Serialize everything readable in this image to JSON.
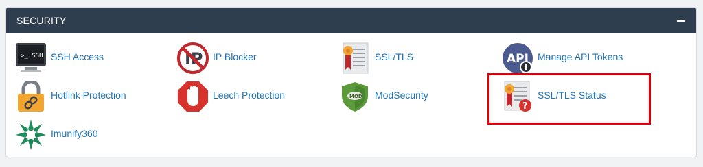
{
  "section": {
    "title": "SECURITY",
    "collapse_icon": "minus-icon"
  },
  "items": [
    {
      "label": "SSH Access",
      "icon": "terminal-icon",
      "icon_text": ">_ SSH"
    },
    {
      "label": "IP Blocker",
      "icon": "ip-blocker-icon",
      "icon_text": "IP"
    },
    {
      "label": "SSL/TLS",
      "icon": "certificate-icon"
    },
    {
      "label": "Manage API Tokens",
      "icon": "api-token-icon",
      "icon_text": "API"
    },
    {
      "label": "Hotlink Protection",
      "icon": "padlock-link-icon"
    },
    {
      "label": "Leech Protection",
      "icon": "stop-hand-icon"
    },
    {
      "label": "ModSecurity",
      "icon": "mod-shield-icon",
      "icon_text": "MOD"
    },
    {
      "label": "SSL/TLS Status",
      "icon": "certificate-question-icon"
    },
    {
      "label": "Imunify360",
      "icon": "imunify-star-icon"
    }
  ],
  "colors": {
    "header_bg": "#2f3e4f",
    "link": "#1f73b7",
    "highlight": "#e0000b"
  }
}
